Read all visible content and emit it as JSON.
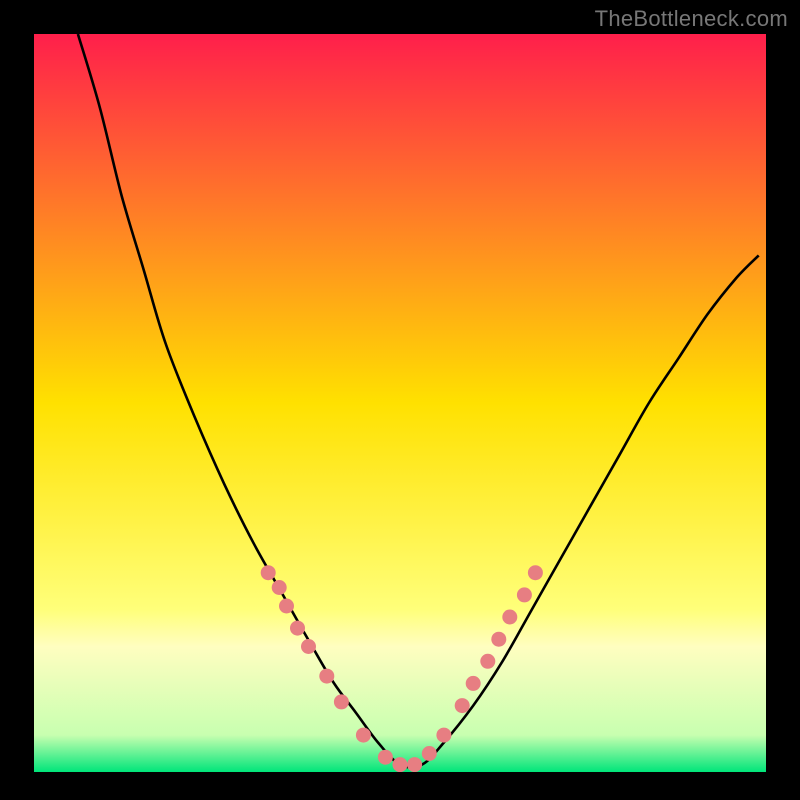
{
  "watermark": "TheBottleneck.com",
  "chart_data": {
    "type": "line",
    "title": "",
    "xlabel": "",
    "ylabel": "",
    "xlim": [
      0,
      100
    ],
    "ylim": [
      0,
      100
    ],
    "background_gradient": {
      "stops": [
        {
          "offset": 0.0,
          "color": "#ff1f4b"
        },
        {
          "offset": 0.5,
          "color": "#ffe100"
        },
        {
          "offset": 0.78,
          "color": "#ffff7a"
        },
        {
          "offset": 0.83,
          "color": "#fffec0"
        },
        {
          "offset": 0.95,
          "color": "#c8ffb0"
        },
        {
          "offset": 1.0,
          "color": "#00e57a"
        }
      ]
    },
    "series": [
      {
        "name": "curve",
        "type": "line",
        "color": "#000000",
        "x": [
          6,
          9,
          12,
          15,
          18,
          22,
          26,
          30,
          34,
          38,
          41,
          44,
          47,
          50,
          53,
          56,
          60,
          64,
          68,
          72,
          76,
          80,
          84,
          88,
          92,
          96,
          99
        ],
        "y": [
          100,
          90,
          78,
          68,
          58,
          48,
          39,
          31,
          24,
          17,
          12,
          8,
          4,
          1,
          1,
          4,
          9,
          15,
          22,
          29,
          36,
          43,
          50,
          56,
          62,
          67,
          70
        ]
      },
      {
        "name": "markers-left",
        "type": "scatter",
        "color": "#e77e82",
        "x": [
          32,
          33.5,
          34.5,
          36,
          37.5,
          40,
          42,
          45,
          48,
          50
        ],
        "y": [
          27,
          25,
          22.5,
          19.5,
          17,
          13,
          9.5,
          5,
          2,
          1
        ]
      },
      {
        "name": "markers-right",
        "type": "scatter",
        "color": "#e77e82",
        "x": [
          52,
          54,
          56,
          58.5,
          60,
          62,
          63.5,
          65,
          67,
          68.5
        ],
        "y": [
          1,
          2.5,
          5,
          9,
          12,
          15,
          18,
          21,
          24,
          27
        ]
      }
    ]
  }
}
